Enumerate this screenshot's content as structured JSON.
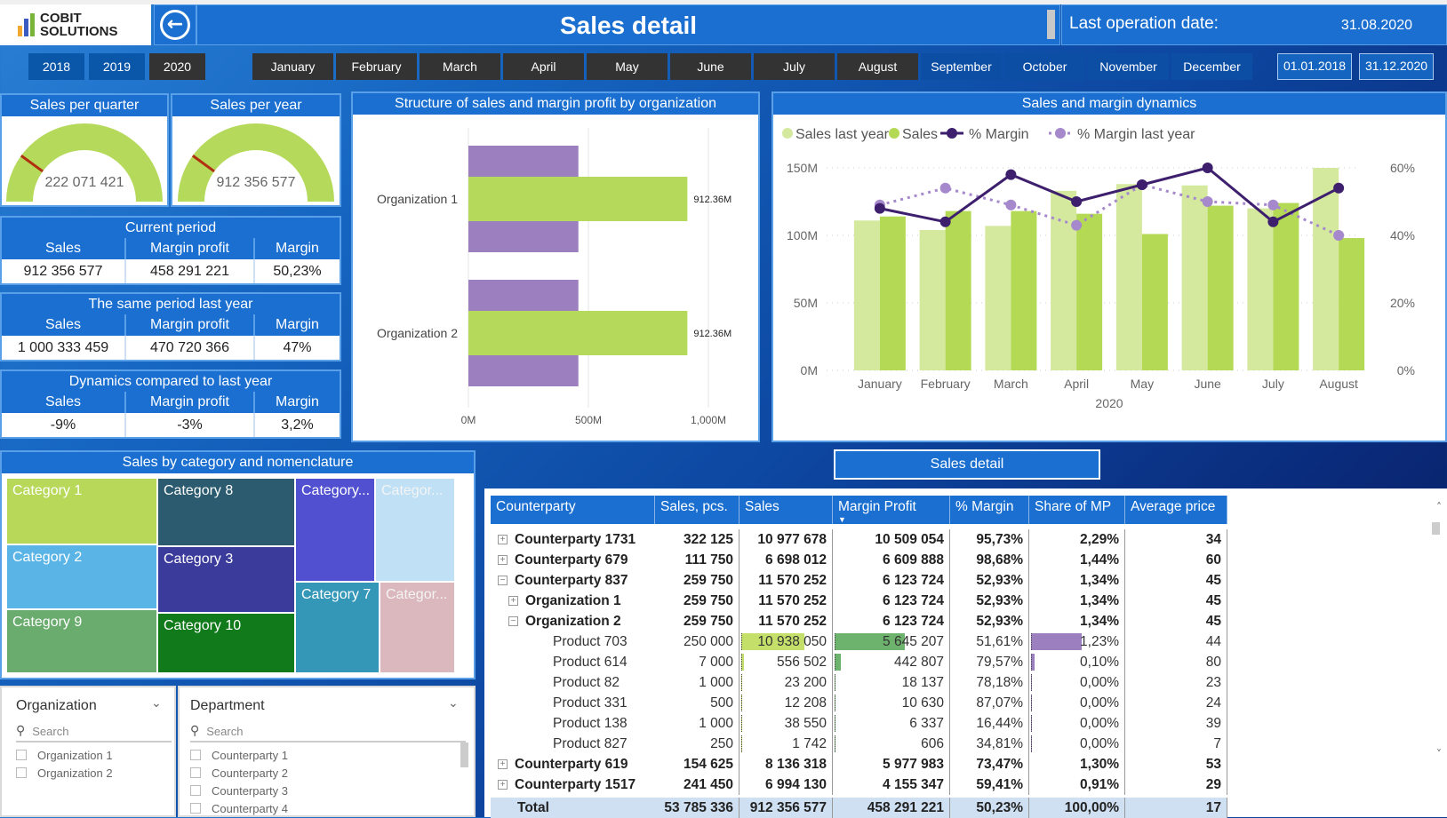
{
  "header": {
    "logo_line1": "COBIT",
    "logo_line2": "SOLUTIONS",
    "back_icon": "arrow-left-circle-icon",
    "title": "Sales detail",
    "last_operation_label": "Last operation date:",
    "last_operation_date": "31.08.2020"
  },
  "years": [
    {
      "label": "2018",
      "selected": false
    },
    {
      "label": "2019",
      "selected": false
    },
    {
      "label": "2020",
      "selected": true
    }
  ],
  "months": [
    {
      "label": "January",
      "selected": true
    },
    {
      "label": "February",
      "selected": true
    },
    {
      "label": "March",
      "selected": true
    },
    {
      "label": "April",
      "selected": true
    },
    {
      "label": "May",
      "selected": true
    },
    {
      "label": "June",
      "selected": true
    },
    {
      "label": "July",
      "selected": true
    },
    {
      "label": "August",
      "selected": true
    },
    {
      "label": "September",
      "selected": false
    },
    {
      "label": "October",
      "selected": false
    },
    {
      "label": "November",
      "selected": false
    },
    {
      "label": "December",
      "selected": false
    }
  ],
  "date_range": {
    "start": "01.01.2018",
    "end": "31.12.2020"
  },
  "gauges": [
    {
      "title": "Sales per quarter",
      "value": "222 071 421",
      "target_fraction": 0.2
    },
    {
      "title": "Sales per year",
      "value": "912 356 577",
      "target_fraction": 0.2
    }
  ],
  "kpis": [
    {
      "title": "Current period",
      "headers": [
        "Sales",
        "Margin profit",
        "Margin"
      ],
      "values": [
        "912 356 577",
        "458 291 221",
        "50,23%"
      ]
    },
    {
      "title": "The same period last year",
      "headers": [
        "Sales",
        "Margin profit",
        "Margin"
      ],
      "values": [
        "1 000 333 459",
        "470 720 366",
        "47%"
      ]
    },
    {
      "title": "Dynamics compared to last year",
      "headers": [
        "Sales",
        "Margin profit",
        "Margin"
      ],
      "values": [
        "-9%",
        "-3%",
        "3,2%"
      ]
    }
  ],
  "chart_data": [
    {
      "type": "bar",
      "orientation": "horizontal",
      "title": "Structure of sales and margin profit by organization",
      "categories": [
        "Organization 1",
        "Organization 2"
      ],
      "series": [
        {
          "name": "Margin profit",
          "values": [
            458.29,
            458.29
          ],
          "color": "#9b7fbf"
        },
        {
          "name": "Sales",
          "values": [
            912.36,
            912.36
          ],
          "color": "#b5d95a",
          "labels": [
            "912.36M",
            "912.36M"
          ]
        }
      ],
      "xlim": [
        0,
        1100
      ],
      "xticks": [
        "0M",
        "500M",
        "1,000M"
      ],
      "xtick_values": [
        0,
        500,
        1000
      ],
      "grid": true
    },
    {
      "type": "bar+line",
      "title": "Sales and margin dynamics",
      "categories": [
        "January",
        "February",
        "March",
        "April",
        "May",
        "June",
        "July",
        "August"
      ],
      "xlabel": "2020",
      "legend": [
        "Sales last year",
        "Sales",
        "% Margin",
        "% Margin last year"
      ],
      "legend_position": "top-left",
      "series": [
        {
          "name": "Sales last year",
          "type": "bar",
          "axis": "left",
          "color": "#d4e89e",
          "values": [
            111,
            104,
            107,
            133,
            138,
            137,
            120,
            150
          ]
        },
        {
          "name": "Sales",
          "type": "bar",
          "axis": "left",
          "color": "#b3d955",
          "values": [
            114,
            118,
            118,
            116,
            101,
            122,
            124,
            98
          ]
        },
        {
          "name": "% Margin",
          "type": "line",
          "axis": "right",
          "color": "#3d1f6e",
          "values": [
            48,
            44,
            58,
            50,
            55,
            60,
            44,
            54
          ]
        },
        {
          "name": "% Margin last year",
          "type": "line",
          "dashed": true,
          "axis": "right",
          "color": "#a688cc",
          "values": [
            49,
            54,
            49,
            43,
            55,
            50,
            49,
            40
          ]
        }
      ],
      "ylim_left": [
        0,
        150
      ],
      "yticks_left": [
        "0M",
        "50M",
        "100M",
        "150M"
      ],
      "ylim_right": [
        0,
        60
      ],
      "yticks_right": [
        "0%",
        "20%",
        "40%",
        "60%"
      ],
      "grid": true
    }
  ],
  "treemap": {
    "title": "Sales by category and nomenclature",
    "tiles": [
      {
        "label": "Category 1",
        "color": "#b8d85a"
      },
      {
        "label": "Category 2",
        "color": "#5ab4e5"
      },
      {
        "label": "Category 9",
        "color": "#6aab6e"
      },
      {
        "label": "Category 8",
        "color": "#2c5a6e"
      },
      {
        "label": "Category 3",
        "color": "#3b3b9c"
      },
      {
        "label": "Category 10",
        "color": "#117a1a"
      },
      {
        "label": "Category...",
        "color": "#5050d0"
      },
      {
        "label": "Categor...",
        "color": "#bfe0f5"
      },
      {
        "label": "Category 7",
        "color": "#3497b8"
      },
      {
        "label": "Categor...",
        "color": "#dbb8bd"
      }
    ]
  },
  "slicers": {
    "organization": {
      "title": "Organization",
      "search_placeholder": "Search",
      "items": [
        "Organization 1",
        "Organization 2"
      ]
    },
    "department": {
      "title": "Department",
      "search_placeholder": "Search",
      "items": [
        "Counterparty 1",
        "Counterparty 2",
        "Counterparty 3",
        "Counterparty 4"
      ]
    }
  },
  "sales_detail_button": "Sales detail",
  "table": {
    "headers": [
      "Counterparty",
      "Sales, pcs.",
      "Sales",
      "Margin Profit",
      "% Margin",
      "Share of MP",
      "Average price"
    ],
    "sort_column": "Margin Profit",
    "rows": [
      {
        "level": 0,
        "expand": "+",
        "bold": true,
        "cells": [
          "Counterparty 1731",
          "322 125",
          "10 977 678",
          "10 509 054",
          "95,73%",
          "2,29%",
          "34"
        ]
      },
      {
        "level": 0,
        "expand": "+",
        "bold": true,
        "cells": [
          "Counterparty 679",
          "111 750",
          "6 698 012",
          "6 609 888",
          "98,68%",
          "1,44%",
          "60"
        ]
      },
      {
        "level": 0,
        "expand": "-",
        "bold": true,
        "cells": [
          "Counterparty 837",
          "259 750",
          "11 570 252",
          "6 123 724",
          "52,93%",
          "1,34%",
          "45"
        ]
      },
      {
        "level": 1,
        "expand": "+",
        "bold": true,
        "cells": [
          "Organization 1",
          "259 750",
          "11 570 252",
          "6 123 724",
          "52,93%",
          "1,34%",
          "45"
        ]
      },
      {
        "level": 1,
        "expand": "-",
        "bold": true,
        "cells": [
          "Organization 2",
          "259 750",
          "11 570 252",
          "6 123 724",
          "52,93%",
          "1,34%",
          "45"
        ]
      },
      {
        "level": 2,
        "expand": "",
        "bold": false,
        "cells": [
          "Product 703",
          "250 000",
          "10 938 050",
          "5 645 207",
          "51,61%",
          "1,23%",
          "44"
        ],
        "bars": [
          0.68,
          0.6,
          0.53
        ]
      },
      {
        "level": 2,
        "expand": "",
        "bold": false,
        "cells": [
          "Product 614",
          "7 000",
          "556 502",
          "442 807",
          "79,57%",
          "0,10%",
          "80"
        ],
        "bars": [
          0.03,
          0.05,
          0.04
        ]
      },
      {
        "level": 2,
        "expand": "",
        "bold": false,
        "cells": [
          "Product 82",
          "1 000",
          "23 200",
          "18 137",
          "78,18%",
          "0,00%",
          "23"
        ],
        "bars": [
          0,
          0,
          0
        ]
      },
      {
        "level": 2,
        "expand": "",
        "bold": false,
        "cells": [
          "Product 331",
          "500",
          "12 208",
          "10 630",
          "87,07%",
          "0,00%",
          "24"
        ],
        "bars": [
          0,
          0,
          0
        ]
      },
      {
        "level": 2,
        "expand": "",
        "bold": false,
        "cells": [
          "Product 138",
          "1 000",
          "38 550",
          "6 337",
          "16,44%",
          "0,00%",
          "39"
        ],
        "bars": [
          0,
          0,
          0
        ]
      },
      {
        "level": 2,
        "expand": "",
        "bold": false,
        "cells": [
          "Product 827",
          "250",
          "1 742",
          "606",
          "34,81%",
          "0,00%",
          "7"
        ],
        "bars": [
          0,
          0,
          0
        ]
      },
      {
        "level": 0,
        "expand": "+",
        "bold": true,
        "cells": [
          "Counterparty 619",
          "154 625",
          "8 136 318",
          "5 977 983",
          "73,47%",
          "1,30%",
          "53"
        ]
      },
      {
        "level": 0,
        "expand": "+",
        "bold": true,
        "cells": [
          "Counterparty 1517",
          "241 450",
          "6 994 130",
          "4 155 347",
          "59,41%",
          "0,91%",
          "29"
        ]
      }
    ],
    "total": [
      "Total",
      "53 785 336",
      "912 356 577",
      "458 291 221",
      "50,23%",
      "100,00%",
      "17"
    ],
    "databar_colors": {
      "sales": "#c5e06a",
      "margin_profit": "#6db36d",
      "share_of_mp": "#9b7fbf"
    }
  }
}
